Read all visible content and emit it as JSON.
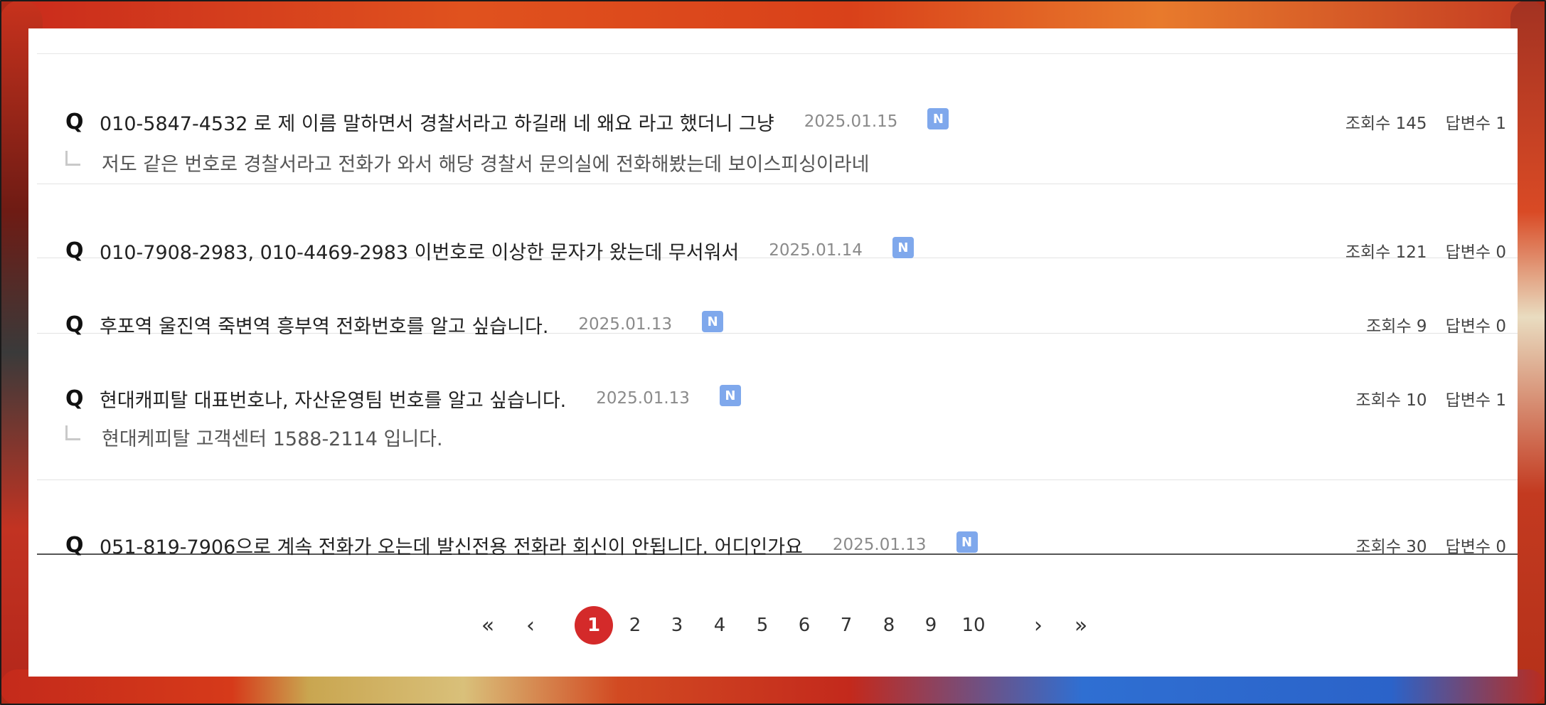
{
  "items": [
    {
      "q": "Q",
      "title": "010-5847-4532 로 제 이름 말하면서 경찰서라고 하길래 네 왜요 라고 했더니 그냥",
      "date": "2025.01.15",
      "badge": "N",
      "views": "조회수 145",
      "answers": "답변수 1",
      "answer_text": "저도 같은 번호로 경찰서라고 전화가 와서 해당 경찰서 문의실에 전화해봤는데 보이스피싱이라네"
    },
    {
      "q": "Q",
      "title": "010-7908-2983, 010-4469-2983 이번호로 이상한 문자가 왔는데 무서워서",
      "date": "2025.01.14",
      "badge": "N",
      "views": "조회수 121",
      "answers": "답변수 0"
    },
    {
      "q": "Q",
      "title": "후포역 울진역 죽변역 흥부역 전화번호를 알고 싶습니다.",
      "date": "2025.01.13",
      "badge": "N",
      "views": "조회수 9",
      "answers": "답변수 0"
    },
    {
      "q": "Q",
      "title": "현대캐피탈 대표번호나, 자산운영팀 번호를 알고 싶습니다.",
      "date": "2025.01.13",
      "badge": "N",
      "views": "조회수 10",
      "answers": "답변수 1",
      "answer_text": "현대케피탈 고객센터 1588-2114 입니다."
    },
    {
      "q": "Q",
      "title": "051-819-7906으로 계속 전화가 오는데 발신전용 전화라 회신이 안됩니다. 어디인가요",
      "date": "2025.01.13",
      "badge": "N",
      "views": "조회수 30",
      "answers": "답변수 0"
    }
  ],
  "pagination": {
    "first": "«",
    "prev": "‹",
    "pages": [
      "1",
      "2",
      "3",
      "4",
      "5",
      "6",
      "7",
      "8",
      "9",
      "10"
    ],
    "current": "1",
    "next": "›",
    "last": "»"
  },
  "colors": {
    "badge": "#7fa8ec",
    "active_page": "#d42a2a"
  }
}
